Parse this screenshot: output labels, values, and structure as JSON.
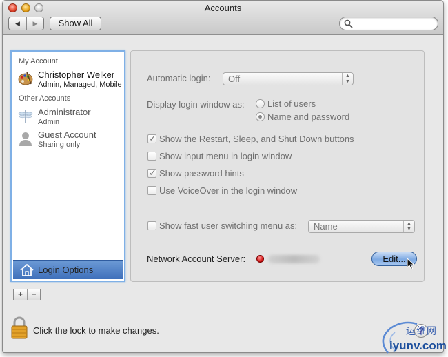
{
  "window": {
    "title": "Accounts"
  },
  "toolbar": {
    "show_all_label": "Show All",
    "back_icon": "arrow-left-icon",
    "forward_icon": "arrow-right-icon",
    "search_placeholder": ""
  },
  "sidebar": {
    "my_account_label": "My Account",
    "my_account": {
      "name": "Christopher Welker",
      "subtitle": "Admin, Managed, Mobile",
      "icon": "palette-avatar-icon"
    },
    "other_accounts_label": "Other Accounts",
    "other_accounts": [
      {
        "name": "Administrator",
        "subtitle": "Admin",
        "icon": "dragonfly-avatar-icon"
      },
      {
        "name": "Guest Account",
        "subtitle": "Sharing only",
        "icon": "person-silhouette-icon"
      }
    ],
    "login_options_label": "Login Options",
    "add_label": "+",
    "remove_label": "−"
  },
  "panel": {
    "automatic_login_label": "Automatic login:",
    "automatic_login_value": "Off",
    "display_login_label": "Display login window as:",
    "display_options": [
      {
        "label": "List of users",
        "selected": false
      },
      {
        "label": "Name and password",
        "selected": true
      }
    ],
    "checkboxes": [
      {
        "label": "Show the Restart, Sleep, and Shut Down buttons",
        "checked": true
      },
      {
        "label": "Show input menu in login window",
        "checked": false
      },
      {
        "label": "Show password hints",
        "checked": true
      },
      {
        "label": "Use VoiceOver in the login window",
        "checked": false
      }
    ],
    "fast_user_switching_label": "Show fast user switching menu as:",
    "fast_user_switching_checked": false,
    "fast_user_switching_value": "Name",
    "network_server_label": "Network Account Server:",
    "network_status_color": "#d41616",
    "edit_button_label": "Edit..."
  },
  "footer": {
    "lock_text": "Click the lock to make changes.",
    "help_label": "?"
  },
  "watermark": {
    "top": "运维网",
    "bottom": "iyunv.com"
  }
}
